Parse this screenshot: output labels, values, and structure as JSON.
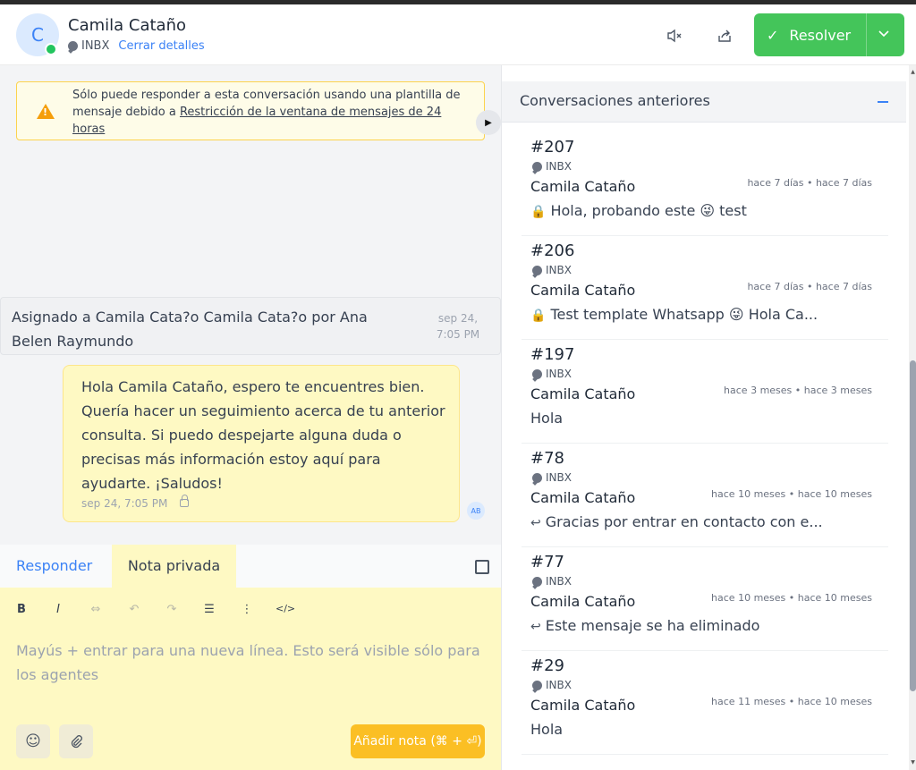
{
  "header": {
    "avatar_initial": "C",
    "contact_name": "Camila Cataño",
    "inbox": "INBX",
    "close_details": "Cerrar detalles",
    "mute_icon": "speaker-mute-icon",
    "share_icon": "share-icon",
    "resolve_label": "Resolver",
    "resolve_color": "#44c55a"
  },
  "banner": {
    "text_before": "Sólo puede responder a esta conversación usando una plantilla de mensaje debido a",
    "link_text": "Restricción de la ventana de mensajes de 24 horas"
  },
  "activity": {
    "text": "Asignado a Camila Cata?o Camila Cata?o por Ana Belen Raymundo",
    "time": "sep 24, 7:05 PM"
  },
  "message": {
    "text": "Hola Camila Cataño, espero te encuentres bien. Quería hacer un seguimiento acerca de tu anterior consulta. Si puedo despejarte alguna duda o precisas más información estoy aquí para ayudarte. ¡Saludos!",
    "time": "sep 24, 7:05 PM",
    "agent_initials": "AB"
  },
  "composer": {
    "tab_reply": "Responder",
    "tab_note": "Nota privada",
    "toolbar": {
      "bold": "B",
      "italic": "I",
      "link": "⇔",
      "undo": "↶",
      "redo": "↷",
      "bullets": "☰",
      "numbered": "⋮",
      "code": "</>"
    },
    "placeholder": "Mayús + entrar para una nueva línea. Esto será visible sólo para los agentes",
    "emoji_icon": "☺",
    "attach_icon": "📎",
    "submit_label": "Añadir nota (⌘ + ⏎)"
  },
  "previous": {
    "title": "Conversaciones anteriores",
    "items": [
      {
        "id": "#207",
        "inbox": "INBX",
        "name": "Camila Cataño",
        "time": "hace 7 días • hace 7 días",
        "icon": "🔒",
        "preview": "Hola, probando este 😜 test"
      },
      {
        "id": "#206",
        "inbox": "INBX",
        "name": "Camila Cataño",
        "time": "hace 7 días • hace 7 días",
        "icon": "🔒",
        "preview": "Test template Whatsapp 😜 Hola Ca..."
      },
      {
        "id": "#197",
        "inbox": "INBX",
        "name": "Camila Cataño",
        "time": "hace 3 meses • hace 3 meses",
        "icon": "",
        "preview": "Hola"
      },
      {
        "id": "#78",
        "inbox": "INBX",
        "name": "Camila Cataño",
        "time": "hace 10 meses • hace 10 meses",
        "icon": "↩",
        "preview": "Gracias por entrar en contacto con e..."
      },
      {
        "id": "#77",
        "inbox": "INBX",
        "name": "Camila Cataño",
        "time": "hace 10 meses • hace 10 meses",
        "icon": "↩",
        "preview": "Este mensaje se ha eliminado"
      },
      {
        "id": "#29",
        "inbox": "INBX",
        "name": "Camila Cataño",
        "time": "hace 11 meses • hace 10 meses",
        "icon": "",
        "preview": "Hola"
      }
    ]
  }
}
